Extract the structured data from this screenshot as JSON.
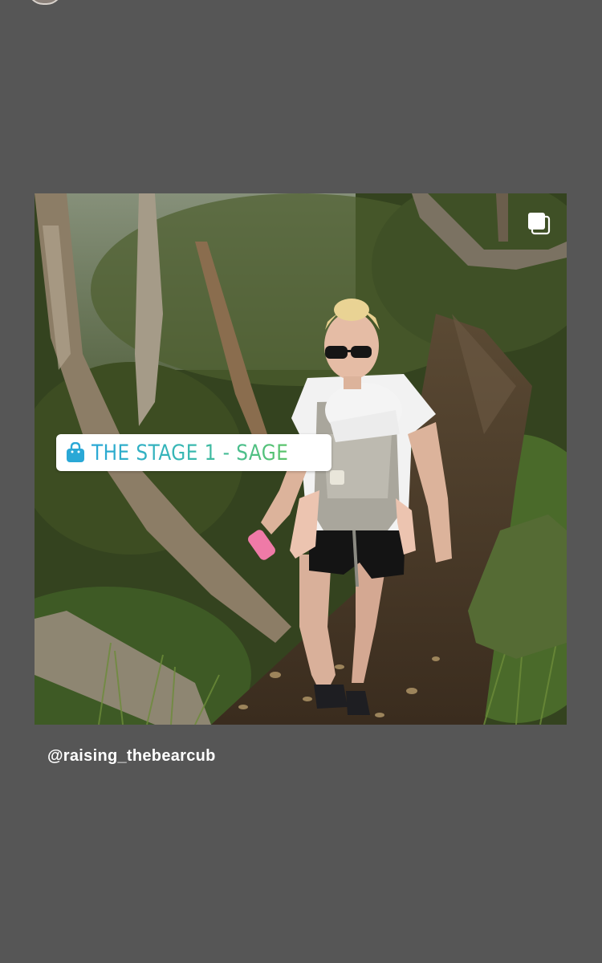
{
  "story": {
    "product_tag": {
      "label": "THE STAGE 1 - SAGE",
      "icon": "shopping-bag-icon",
      "icon_color": "#2aa8d6"
    },
    "multi_image_icon": "multiple-photos-icon",
    "credit": "@raising_thebearcub",
    "background_color": "#565656"
  }
}
